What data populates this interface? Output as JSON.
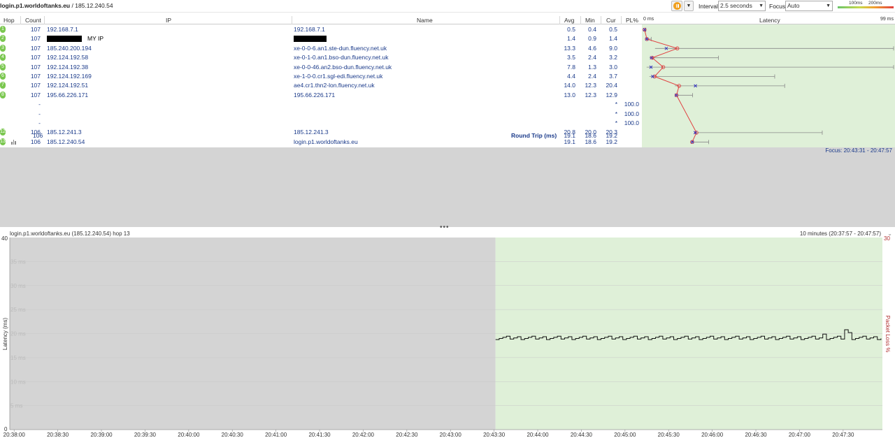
{
  "toolbar": {
    "target_host": "login.p1.worldoftanks.eu",
    "target_sep": " / ",
    "target_ip": "185.12.240.54",
    "interval_label": "Interval",
    "interval_value": "2.5 seconds",
    "focus_label": "Focus",
    "focus_value": "Auto",
    "legend_100": "100ms",
    "legend_200": "200ms",
    "pause_icon": "pause-icon",
    "dropdown_icon": "chevron-down-icon"
  },
  "table": {
    "headers": {
      "hop": "Hop",
      "count": "Count",
      "ip": "IP",
      "name": "Name",
      "avg": "Avg",
      "min": "Min",
      "cur": "Cur",
      "pl": "PL%",
      "latency": "Latency"
    },
    "latency_min_label": "0 ms",
    "latency_max_label": "99 ms",
    "rows": [
      {
        "hop": "1",
        "count": "107",
        "ip": "192.168.7.1",
        "name": "192.168.7.1",
        "avg": "0.5",
        "min": "0.4",
        "cur": "0.5",
        "pl": ""
      },
      {
        "hop": "2",
        "count": "107",
        "ip": "",
        "ip_note": "MY IP",
        "name": "",
        "avg": "1.4",
        "min": "0.9",
        "cur": "1.4",
        "pl": "",
        "redacted": true
      },
      {
        "hop": "3",
        "count": "107",
        "ip": "185.240.200.194",
        "name": "xe-0-0-6.an1.ste-dun.fluency.net.uk",
        "avg": "13.3",
        "min": "4.6",
        "cur": "9.0",
        "pl": ""
      },
      {
        "hop": "4",
        "count": "107",
        "ip": "192.124.192.58",
        "name": "xe-0-1-0.an1.bso-dun.fluency.net.uk",
        "avg": "3.5",
        "min": "2.4",
        "cur": "3.2",
        "pl": ""
      },
      {
        "hop": "5",
        "count": "107",
        "ip": "192.124.192.38",
        "name": "xe-0-0-46.an2.bso-dun.fluency.net.uk",
        "avg": "7.8",
        "min": "1.3",
        "cur": "3.0",
        "pl": ""
      },
      {
        "hop": "6",
        "count": "107",
        "ip": "192.124.192.169",
        "name": "xe-1-0-0.cr1.sgl-edi.fluency.net.uk",
        "avg": "4.4",
        "min": "2.4",
        "cur": "3.7",
        "pl": ""
      },
      {
        "hop": "7",
        "count": "107",
        "ip": "192.124.192.51",
        "name": "ae4.cr1.thn2-lon.fluency.net.uk",
        "avg": "14.0",
        "min": "12.3",
        "cur": "20.4",
        "pl": ""
      },
      {
        "hop": "8",
        "count": "107",
        "ip": "195.66.226.171",
        "name": "195.66.226.171",
        "avg": "13.0",
        "min": "12.3",
        "cur": "12.9",
        "pl": ""
      },
      {
        "hop": "",
        "count": "-",
        "ip": "",
        "name": "",
        "avg": "",
        "min": "",
        "cur": "*",
        "pl": "100.0"
      },
      {
        "hop": "",
        "count": "-",
        "ip": "",
        "name": "",
        "avg": "",
        "min": "",
        "cur": "*",
        "pl": "100.0"
      },
      {
        "hop": "",
        "count": "-",
        "ip": "",
        "name": "",
        "avg": "",
        "min": "",
        "cur": "*",
        "pl": "100.0"
      },
      {
        "hop": "12",
        "count": "106",
        "ip": "185.12.241.3",
        "name": "185.12.241.3",
        "avg": "20.8",
        "min": "20.0",
        "cur": "20.3",
        "pl": ""
      },
      {
        "hop": "13",
        "count": "106",
        "ip": "185.12.240.54",
        "name": "login.p1.worldoftanks.eu",
        "avg": "19.1",
        "min": "18.6",
        "cur": "19.2",
        "pl": ""
      }
    ],
    "summary": {
      "count": "106",
      "label": "Round Trip (ms)",
      "avg": "19.1",
      "min": "18.6",
      "cur": "19.2"
    },
    "focus_text": "Focus: 20:43:31 - 20:47:57"
  },
  "timeline": {
    "title": "login.p1.worldoftanks.eu (185.12.240.54) hop 13",
    "range": "10 minutes (20:37:57 - 20:47:57)",
    "y_left_label": "Latency (ms)",
    "y_right_label": "Packet Loss %",
    "y_left_max": "40",
    "y_left_min": "0",
    "y_right_max": "30",
    "gridlines": [
      "35 ms",
      "30 ms",
      "25 ms",
      "20 ms",
      "15 ms",
      "10 ms",
      "5 ms"
    ],
    "x_ticks": [
      "20:38:00",
      "20:38:30",
      "20:39:00",
      "20:39:30",
      "20:40:00",
      "20:40:30",
      "20:41:00",
      "20:41:30",
      "20:42:00",
      "20:42:30",
      "20:43:00",
      "20:43:30",
      "20:44:00",
      "20:44:30",
      "20:45:00",
      "20:45:30",
      "20:46:00",
      "20:46:30",
      "20:47:00",
      "20:47:30"
    ]
  },
  "colors": {
    "focus_bg": "#dff0d8",
    "unfocused_bg": "#d4d4d4",
    "hop_badge": "#7ac74f",
    "avg_line": "#e04040",
    "text_blue": "#1a3a8a"
  },
  "chart_data": {
    "type": "line",
    "title": "login.p1.worldoftanks.eu (185.12.240.54) hop 13",
    "xlabel": "",
    "ylabel": "Latency (ms)",
    "ylim": [
      0,
      40
    ],
    "grid": true,
    "x": [
      "20:43:30",
      "20:44:00",
      "20:44:30",
      "20:45:00",
      "20:45:30",
      "20:46:00",
      "20:46:30",
      "20:47:00",
      "20:47:30",
      "20:47:57"
    ],
    "series": [
      {
        "values": [
          19.0,
          19.2,
          19.1,
          19.0,
          20.8,
          20.5,
          19.3,
          19.1,
          19.2,
          19.2
        ]
      }
    ]
  }
}
